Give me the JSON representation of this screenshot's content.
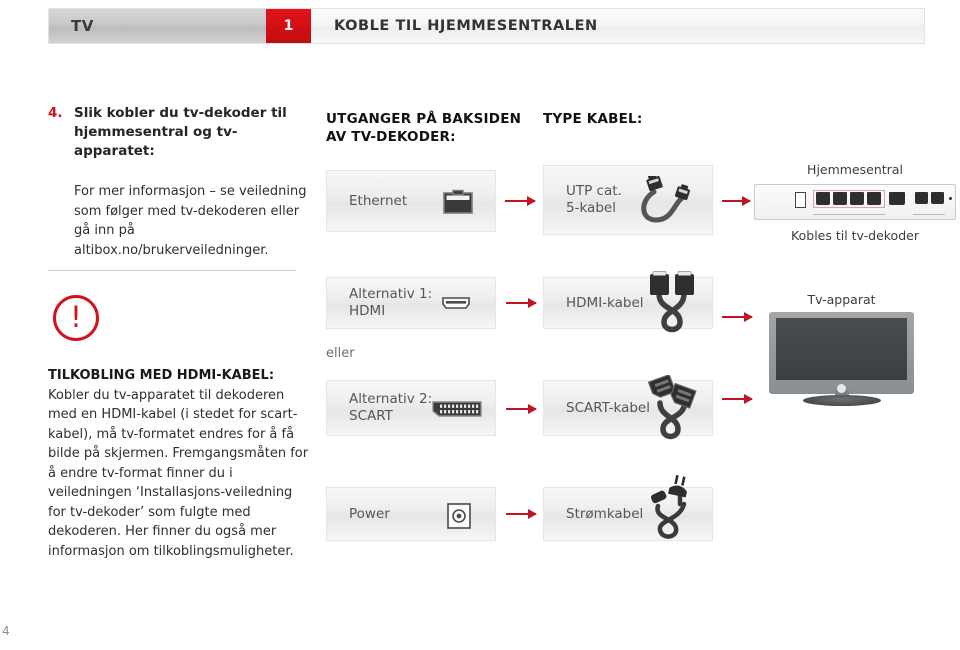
{
  "header": {
    "tab_label": "TV",
    "step_badge": "1",
    "title": "KOBLE TIL HJEMMESENTRALEN",
    "accent_red": "#d40f16",
    "tab_gray": "#c8c8c8"
  },
  "step": {
    "number": "4.",
    "heading": "Slik kobler du tv-dekoder til hjemmesentral og tv-apparatet:",
    "body": "For mer informasjon – se veiledning som følger med tv-dekoderen eller gå inn på altibox.no/brukerveiledninger."
  },
  "warning": {
    "icon": "exclamation-circle-icon",
    "icon_color": "#cf1420",
    "title": "TILKOBLING MED HDMI-KABEL:",
    "body": "Kobler du tv-apparatet til dekoderen med en HDMI-kabel (i stedet for scart-kabel), må tv-formatet endres for å få bilde på skjermen. Fremgangsmåten for å endre tv-format finner du  i veiledningen ‘Installasjons-veiledning for tv-dekoder’ som fulgte med dekoderen. Her finner du også mer informasjon om tilkoblingsmuligheter."
  },
  "columns": {
    "ports_heading_line1": "UTGANGER PÅ BAKSIDEN",
    "ports_heading_line2": "AV TV-DEKODER:",
    "cable_heading": "TYPE KABEL:"
  },
  "rows": [
    {
      "port_label_line1": "Ethernet",
      "port_label_line2": "",
      "port_icon": "ethernet-port-icon",
      "cable_label_line1": "UTP cat.",
      "cable_label_line2": "5-kabel",
      "cable_icon": "utp-cable-icon"
    },
    {
      "port_label_line1": "Alternativ 1:",
      "port_label_line2": "HDMI",
      "port_icon": "hdmi-port-icon",
      "cable_label_line1": "HDMI-kabel",
      "cable_label_line2": "",
      "cable_icon": "hdmi-cable-icon"
    },
    {
      "port_label_line1": "Alternativ 2:",
      "port_label_line2": "SCART",
      "port_icon": "scart-port-icon",
      "cable_label_line1": "SCART-kabel",
      "cable_label_line2": "",
      "cable_icon": "scart-cable-icon"
    },
    {
      "port_label_line1": "Power",
      "port_label_line2": "",
      "port_icon": "power-port-icon",
      "cable_label_line1": "Strømkabel",
      "cable_label_line2": "",
      "cable_icon": "power-cable-icon"
    }
  ],
  "or_label": "eller",
  "devices": {
    "router_caption_top": "Hjemmesentral",
    "router_caption_bottom": "Kobles til tv-dekoder",
    "tv_caption": "Tv-apparat"
  },
  "footer": {
    "page_number": "4"
  }
}
